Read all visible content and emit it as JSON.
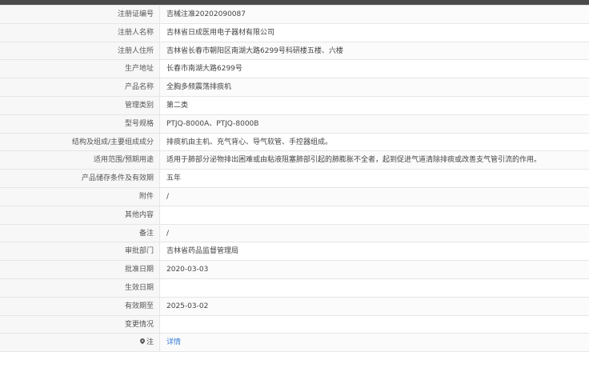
{
  "rows": [
    {
      "label": "注册证编号",
      "value": "吉械注准20202090087"
    },
    {
      "label": "注册人名称",
      "value": "吉林省日成医用电子器材有限公司"
    },
    {
      "label": "注册人住所",
      "value": "吉林省长春市朝阳区南湖大路6299号科研楼五楼、六楼"
    },
    {
      "label": "生产地址",
      "value": "长春市南湖大路6299号"
    },
    {
      "label": "产品名称",
      "value": "全胸多频震荡排痰机"
    },
    {
      "label": "管理类别",
      "value": "第二类"
    },
    {
      "label": "型号规格",
      "value": "PTJQ-8000A、PTJQ-8000B"
    },
    {
      "label": "结构及组成/主要组成成分",
      "value": "排痰机由主机、充气背心、导气软管、手控器组成。"
    },
    {
      "label": "适用范围/预期用途",
      "value": "适用于肺部分泌物排出困难或由粘液阻塞肺部引起的肺膨胀不全者，起到促进气道清除排痰或改善支气管引流的作用。"
    },
    {
      "label": "产品储存条件及有效期",
      "value": "五年"
    },
    {
      "label": "附件",
      "value": "/"
    },
    {
      "label": "其他内容",
      "value": ""
    },
    {
      "label": "备注",
      "value": "/"
    },
    {
      "label": "审批部门",
      "value": "吉林省药品监督管理局"
    },
    {
      "label": "批准日期",
      "value": "2020-03-03"
    },
    {
      "label": "生效日期",
      "value": ""
    },
    {
      "label": "有效期至",
      "value": "2025-03-02"
    },
    {
      "label": "变更情况",
      "value": ""
    }
  ],
  "note_row": {
    "icon": "map-pin-icon",
    "label": "注",
    "link_text": "详情",
    "link_color": "#3a7bd5"
  }
}
